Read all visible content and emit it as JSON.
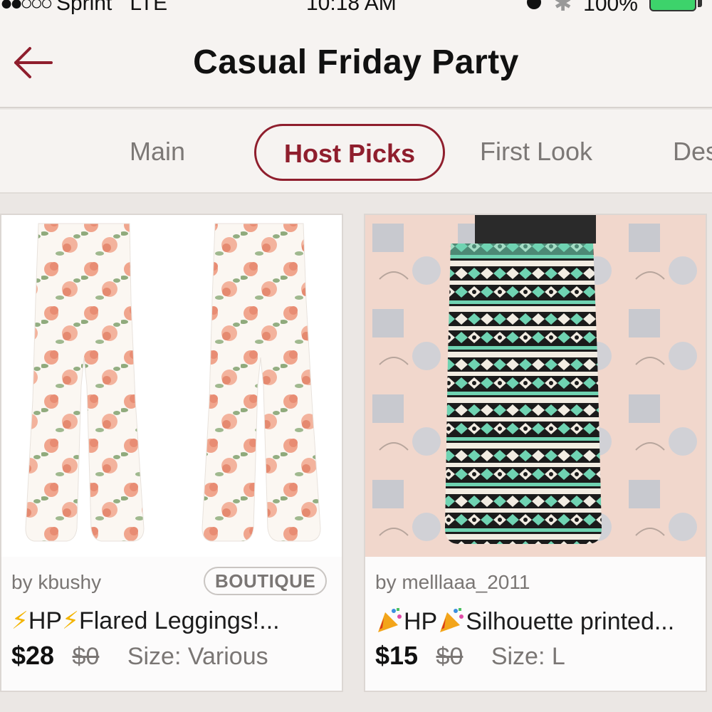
{
  "status_bar": {
    "carrier": "Sprint",
    "network": "LTE",
    "time": "10:18 AM",
    "battery": "100%"
  },
  "header": {
    "title": "Casual Friday Party",
    "accent_color": "#8f1e2d"
  },
  "tabs": [
    {
      "label": "Main",
      "active": false
    },
    {
      "label": "Host Picks",
      "active": true
    },
    {
      "label": "First Look",
      "active": false
    },
    {
      "label": "Des",
      "active": false
    }
  ],
  "listings": [
    {
      "seller": "by kbushy",
      "badge": "BOUTIQUE",
      "title_icon": "lightning-bolt-icon",
      "title": "HP",
      "title_rest": "Flared Leggings!...",
      "price": "$28",
      "original_price": "$0",
      "size": "Size: Various"
    },
    {
      "seller": "by melllaaa_2011",
      "title_icon": "party-popper-icon",
      "title": "HP",
      "title_rest": "Silhouette printed...",
      "price": "$15",
      "original_price": "$0",
      "size": "Size: L"
    }
  ]
}
